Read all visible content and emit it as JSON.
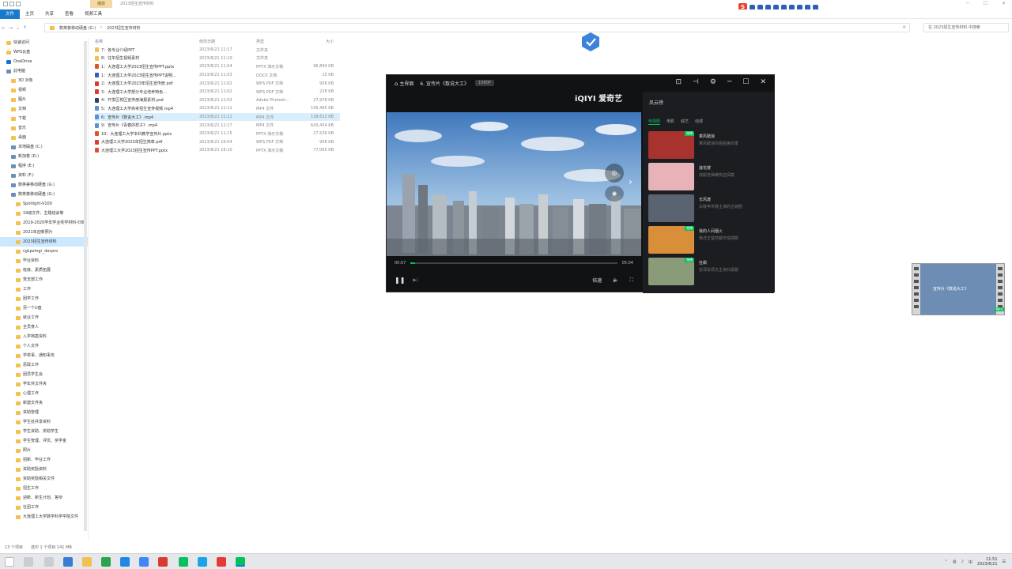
{
  "titlebar": {
    "context_tab": "播放",
    "window_title": "2023招生宣传材料",
    "controls": [
      "─",
      "☐",
      "✕"
    ]
  },
  "ribbon": {
    "tabs": [
      "文件",
      "主页",
      "共享",
      "查看",
      "视频工具"
    ]
  },
  "address": {
    "path": [
      "数英荟移动硬盘 (G:)",
      "2023招生宣传材料"
    ],
    "search_placeholder": "在 2023招生宣传材料 中搜索"
  },
  "nav": {
    "items": [
      {
        "label": "快速访问",
        "selected": false
      },
      {
        "label": "WPS云盘",
        "selected": false
      },
      {
        "label": "OneDrive",
        "selected": false
      },
      {
        "label": "此电脑",
        "selected": false
      },
      {
        "label": "3D 对象",
        "selected": false
      },
      {
        "label": "视频",
        "selected": false
      },
      {
        "label": "图片",
        "selected": false
      },
      {
        "label": "文档",
        "selected": false
      },
      {
        "label": "下载",
        "selected": false
      },
      {
        "label": "音乐",
        "selected": false
      },
      {
        "label": "桌面",
        "selected": false
      },
      {
        "label": "本地磁盘 (C:)",
        "selected": false
      },
      {
        "label": "新加卷 (D:)",
        "selected": false
      },
      {
        "label": "程序 (E:)",
        "selected": false
      },
      {
        "label": "资料 (F:)",
        "selected": false
      },
      {
        "label": "数英荟移动硬盘 (G:)",
        "selected": false
      },
      {
        "label": "数英荟移动硬盘 (G:)",
        "selected": false
      },
      {
        "label": "Spotlight-V100",
        "selected": false
      },
      {
        "label": "19级文件、主题班会等",
        "selected": false
      },
      {
        "label": "2019-2020学年学业奖学材料-归档",
        "selected": false
      },
      {
        "label": "2021年迎新照片",
        "selected": false
      },
      {
        "label": "2023招生宣传材料",
        "selected": true
      },
      {
        "label": "cgLpzmgr_docpro",
        "selected": false
      },
      {
        "label": "毕业资料",
        "selected": false
      },
      {
        "label": "班级、素质拓展",
        "selected": false
      },
      {
        "label": "党支部工作",
        "selected": false
      },
      {
        "label": "工作",
        "selected": false
      },
      {
        "label": "团学工作",
        "selected": false
      },
      {
        "label": "另一个U盘",
        "selected": false
      },
      {
        "label": "就业工作",
        "selected": false
      },
      {
        "label": "全员育人",
        "selected": false
      },
      {
        "label": "入学档案资料",
        "selected": false
      },
      {
        "label": "个人文件",
        "selected": false
      },
      {
        "label": "学校事、通知事务",
        "selected": false
      },
      {
        "label": "思政工作",
        "selected": false
      },
      {
        "label": "团员学生会",
        "selected": false
      },
      {
        "label": "学年共文件夹",
        "selected": false
      },
      {
        "label": "心理工作",
        "selected": false
      },
      {
        "label": "新建文件夹",
        "selected": false
      },
      {
        "label": "资助管理",
        "selected": false
      },
      {
        "label": "学生处共享资料",
        "selected": false
      },
      {
        "label": "学生资助、奖助学生",
        "selected": false
      },
      {
        "label": "学生管理、评优、奖学金",
        "selected": false
      },
      {
        "label": "照片",
        "selected": false
      },
      {
        "label": "招新、毕业工作",
        "selected": false
      },
      {
        "label": "资助奖励资料",
        "selected": false
      },
      {
        "label": "资助奖励相关文件",
        "selected": false
      },
      {
        "label": "招生工作",
        "selected": false
      },
      {
        "label": "迎新、新生计划、答辩",
        "selected": false
      },
      {
        "label": "社团工作",
        "selected": false
      },
      {
        "label": "大连理工大学数学科学学院文件",
        "selected": false
      }
    ]
  },
  "filelist": {
    "headers": [
      "名称",
      "修改日期",
      "类型",
      "大小"
    ],
    "rows": [
      {
        "name": "7：各专业介绍PPT",
        "date": "2023/6/21 11:17",
        "type": "文件夹",
        "size": "",
        "icon": "folder",
        "selected": false
      },
      {
        "name": "8：往年招生视频素材",
        "date": "2023/6/21 11:10",
        "type": "文件夹",
        "size": "",
        "icon": "folder",
        "selected": false
      },
      {
        "name": "1：大连理工大学2023招生宣传PPT.pptx",
        "date": "2023/6/21 11:04",
        "type": "PPTX 演示文稿",
        "size": "96,894 KB",
        "icon": "ppt",
        "selected": false
      },
      {
        "name": "1：大连理工大学2023招生宣传PPT说明...",
        "date": "2023/6/21 11:03",
        "type": "DOCX 文档",
        "size": "15 KB",
        "icon": "doc",
        "selected": false
      },
      {
        "name": "2：大连理工大学2023年招生宣传册.pdf",
        "date": "2023/6/21 11:02",
        "type": "WPS PDF 文档",
        "size": "958 KB",
        "icon": "pdf",
        "selected": false
      },
      {
        "name": "3：大连理工大学部分专业培养特色...",
        "date": "2023/6/21 11:02",
        "type": "WPS PDF 文档",
        "size": "228 KB",
        "icon": "pdf",
        "selected": false
      },
      {
        "name": "4：开发区校区宣传册海报素材.psd",
        "date": "2023/6/21 11:03",
        "type": "Adobe Photosh...",
        "size": "27,978 KB",
        "icon": "psd",
        "selected": false
      },
      {
        "name": "5：大连理工大学高考招生宣传视频.mp4",
        "date": "2023/6/21 11:11",
        "type": "MP4 文件",
        "size": "156,465 KB",
        "icon": "video",
        "selected": false
      },
      {
        "name": "6：宣传片《数说大工》.mp4",
        "date": "2023/6/21 11:11",
        "type": "MP4 文件",
        "size": "138,612 KB",
        "icon": "video",
        "selected": true
      },
      {
        "name": "9：宣传片《青春的样子》.mp4",
        "date": "2023/6/21 11:17",
        "type": "MP4 文件",
        "size": "643,454 KB",
        "icon": "video",
        "selected": false
      },
      {
        "name": "10：大连理工大学本科教学宣传片.pptx",
        "date": "2023/6/21 11:15",
        "type": "PPTX 演示文稿",
        "size": "27,539 KB",
        "icon": "ppt",
        "selected": false
      },
      {
        "name": "大连理工大学2023年招生简章.pdf",
        "date": "2023/6/21 16:04",
        "type": "WPS PDF 文档",
        "size": "958 KB",
        "icon": "pdf",
        "selected": false
      },
      {
        "name": "大连理工大学2023招生宣传PPT.pptx",
        "date": "2023/6/21 16:10",
        "type": "PPTX 演示文稿",
        "size": "77,065 KB",
        "icon": "ppt",
        "selected": false
      }
    ]
  },
  "statusbar": {
    "count": "13 个项目",
    "selected": "选中 1 个项目 141 MB"
  },
  "player": {
    "home_label": "主界面",
    "now_playing": "6. 宣传片《数说大工》",
    "quality_tag": "1080P",
    "logo": "iQIYI 爱奇艺",
    "time_current": "00:07",
    "time_total": "05:04",
    "progress_fraction": 0.02,
    "speed_label": "倍速",
    "sidebar_title": "风云榜",
    "sidebar_tabs": [
      {
        "label": "电视剧",
        "active": true
      },
      {
        "label": "电影",
        "active": false
      },
      {
        "label": "综艺",
        "active": false
      },
      {
        "label": "动漫",
        "active": false
      }
    ],
    "recommendations": [
      {
        "title": "乘风踏浪",
        "subtitle": "乘风破浪的姐姐第四季",
        "badge": "独播",
        "color": "#a8322d"
      },
      {
        "title": "莲花楼",
        "subtitle": "成毅曾舜晞热血探案",
        "badge": "",
        "color": "#e8b3b8"
      },
      {
        "title": "长风渡",
        "subtitle": "白敬亭宋轶主演的古装剧",
        "badge": "",
        "color": "#5a6470"
      },
      {
        "title": "我的人间烟火",
        "subtitle": "杨洋王楚然都市情感剧",
        "badge": "独播",
        "color": "#d98f3a"
      },
      {
        "title": "狂飙",
        "subtitle": "张译张颂文主演扫黑剧",
        "badge": "独播",
        "color": "#8a9b7a"
      }
    ]
  },
  "mini_preview": {
    "label": "宣传片《数说大工》",
    "badge": "MP4"
  },
  "taskbar": {
    "time": "11:51",
    "date": "2023/6/21"
  },
  "colors": {
    "accent": "#1979ca",
    "iqiyi_green": "#00c25a",
    "selection": "#cce8ff"
  }
}
